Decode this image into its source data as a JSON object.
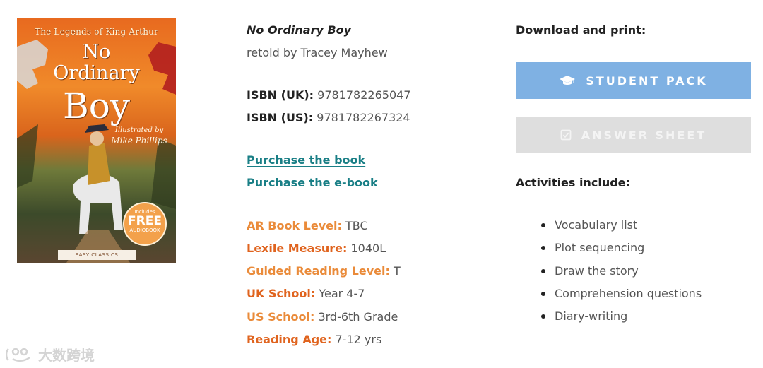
{
  "cover": {
    "series": "The Legends of King Arthur",
    "title_line1": "No",
    "title_line2": "Ordinary",
    "title_line3": "Boy",
    "illustrated_by": "Illustrated by",
    "illustrator": "Mike Phillips",
    "badge_top": "Includes",
    "badge_main": "FREE",
    "badge_bottom": "AUDIOBOOK",
    "ribbon": "EASY CLASSICS"
  },
  "book": {
    "title": "No Ordinary Boy",
    "retold": "retold by Tracey Mayhew",
    "isbn_uk_label": "ISBN (UK):",
    "isbn_uk": "9781782265047",
    "isbn_us_label": "ISBN (US):",
    "isbn_us": "9781782267324"
  },
  "links": {
    "purchase_book": "Purchase the book",
    "purchase_ebook": "Purchase the e-book"
  },
  "meta": {
    "ar_label": "AR Book Level:",
    "ar_value": "TBC",
    "lexile_label": "Lexile Measure:",
    "lexile_value": "1040L",
    "guided_label": "Guided Reading Level:",
    "guided_value": "T",
    "uk_school_label": "UK School:",
    "uk_school_value": "Year 4-7",
    "us_school_label": "US School:",
    "us_school_value": "3rd-6th Grade",
    "reading_age_label": "Reading Age:",
    "reading_age_value": "7-12 yrs"
  },
  "download": {
    "heading": "Download and print:",
    "student_pack": "STUDENT PACK",
    "student_icon": "graduation-cap-icon",
    "answer_sheet": "ANSWER SHEET",
    "answer_icon": "checkbox-icon"
  },
  "activities": {
    "heading": "Activities include:",
    "items": [
      "Vocabulary list",
      "Plot sequencing",
      "Draw the story",
      "Comprehension questions",
      "Diary-writing"
    ]
  },
  "watermark": {
    "text": "大数跨境"
  },
  "colors": {
    "link": "#1a7f86",
    "orange_light": "#ea8b3a",
    "orange_dark": "#e0641f",
    "student_button": "#7fb1e3",
    "answer_button": "#dedede"
  }
}
